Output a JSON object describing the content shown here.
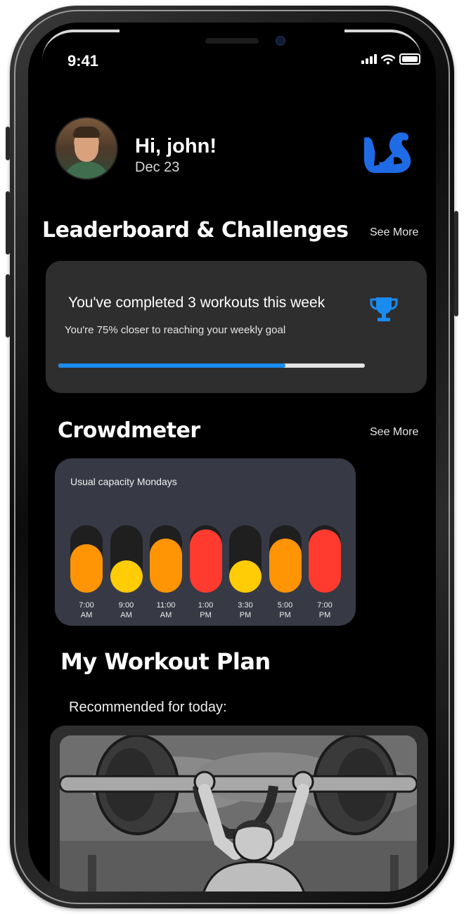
{
  "status_bar": {
    "time": "9:41",
    "icons": [
      "signal-icon",
      "wifi-icon",
      "battery-icon"
    ]
  },
  "header": {
    "greeting": "Hi, john!",
    "date": "Dec 23",
    "logo_icon": "flexed-bicep-icon"
  },
  "leaderboard": {
    "title": "Leaderboard & Challenges",
    "see_more": "See More",
    "card": {
      "main_text": "You've completed 3 workouts this week",
      "sub_text": "You're 75% closer to reaching your weekly goal",
      "icon": "trophy-icon",
      "progress": 0.74
    }
  },
  "crowdmeter": {
    "title": "Crowdmeter",
    "see_more": "See More",
    "caption": "Usual capacity Mondays",
    "bars": [
      {
        "time": "7:00",
        "period": "AM",
        "level": 0.72,
        "color": "#FF9405"
      },
      {
        "time": "9:00",
        "period": "AM",
        "level": 0.48,
        "color": "#FFCC05"
      },
      {
        "time": "11:00",
        "period": "AM",
        "level": 0.8,
        "color": "#FF9405"
      },
      {
        "time": "1:00",
        "period": "PM",
        "level": 0.94,
        "color": "#FF3B30"
      },
      {
        "time": "3:30",
        "period": "PM",
        "level": 0.48,
        "color": "#FFCC05"
      },
      {
        "time": "5:00",
        "period": "PM",
        "level": 0.8,
        "color": "#FF9405"
      },
      {
        "time": "7:00",
        "period": "PM",
        "level": 0.94,
        "color": "#FF3B30"
      }
    ]
  },
  "workout_plan": {
    "title": "My Workout Plan",
    "recommended": "Recommended for today:",
    "image_icon": "weightlifter-illustration"
  },
  "colors": {
    "accent": "#1A8CF0",
    "logo_blue": "#1F6BE6",
    "card": "#2E2E2E",
    "crowd_card": "#373A45"
  }
}
